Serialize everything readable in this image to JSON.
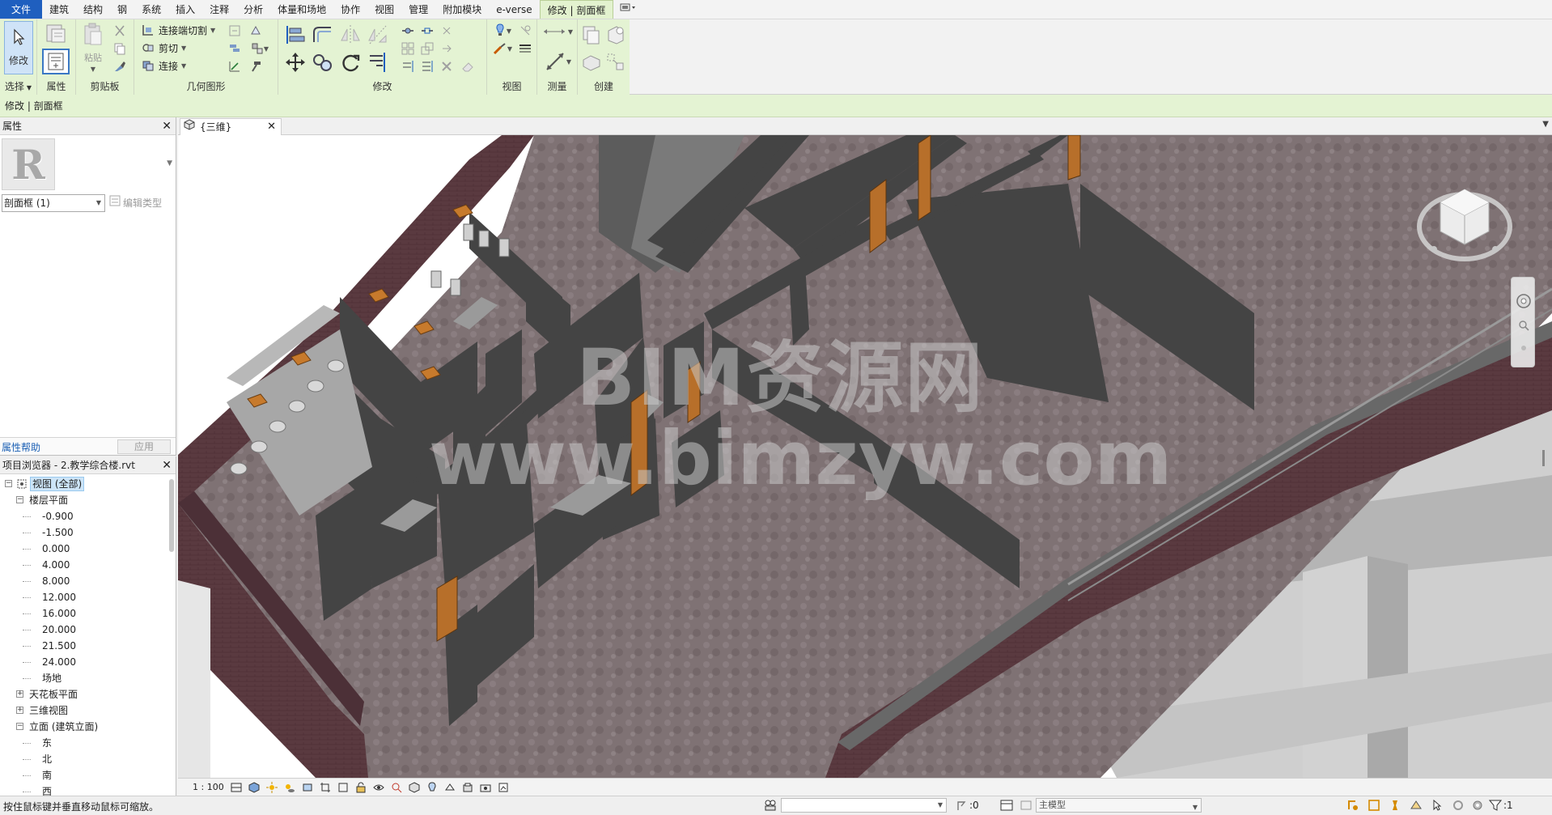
{
  "ribbon": {
    "tabs": [
      {
        "label": "文件",
        "kind": "file"
      },
      {
        "label": "建筑"
      },
      {
        "label": "结构"
      },
      {
        "label": "钢"
      },
      {
        "label": "系统"
      },
      {
        "label": "插入"
      },
      {
        "label": "注释"
      },
      {
        "label": "分析"
      },
      {
        "label": "体量和场地"
      },
      {
        "label": "协作"
      },
      {
        "label": "视图"
      },
      {
        "label": "管理"
      },
      {
        "label": "附加模块"
      },
      {
        "label": "e-verse"
      },
      {
        "label": "修改 | 剖面框",
        "kind": "active"
      }
    ],
    "panels": {
      "select": "选择",
      "properties": "属性",
      "clipboard": "剪贴板",
      "geometry": "几何图形",
      "modify": "修改",
      "view": "视图",
      "measure": "测量",
      "create": "创建"
    },
    "buttons": {
      "modify": "修改",
      "paste": "粘贴",
      "cope": "连接端切割",
      "cut": "剪切",
      "join": "连接"
    }
  },
  "context_bar": "修改 | 剖面框",
  "properties_panel": {
    "title": "属性",
    "type_selector": "剖面框 (1)",
    "edit_type": "编辑类型",
    "help_link": "属性帮助",
    "apply_button": "应用"
  },
  "project_browser": {
    "title": "项目浏览器 - 2.教学综合楼.rvt",
    "tree": [
      {
        "label": "视图 (全部)",
        "level": 0,
        "toggle": "−",
        "selected": true
      },
      {
        "label": "楼层平面",
        "level": 1,
        "toggle": "−"
      },
      {
        "label": "-0.900",
        "level": 2
      },
      {
        "label": "-1.500",
        "level": 2
      },
      {
        "label": "0.000",
        "level": 2
      },
      {
        "label": "4.000",
        "level": 2
      },
      {
        "label": "8.000",
        "level": 2
      },
      {
        "label": "12.000",
        "level": 2
      },
      {
        "label": "16.000",
        "level": 2
      },
      {
        "label": "20.000",
        "level": 2
      },
      {
        "label": "21.500",
        "level": 2
      },
      {
        "label": "24.000",
        "level": 2
      },
      {
        "label": "场地",
        "level": 2
      },
      {
        "label": "天花板平面",
        "level": 1,
        "toggle": "+"
      },
      {
        "label": "三维视图",
        "level": 1,
        "toggle": "+"
      },
      {
        "label": "立面 (建筑立面)",
        "level": 1,
        "toggle": "−"
      },
      {
        "label": "东",
        "level": 2
      },
      {
        "label": "北",
        "level": 2
      },
      {
        "label": "南",
        "level": 2
      },
      {
        "label": "西",
        "level": 2
      }
    ]
  },
  "view_tab": {
    "label": "{三维}"
  },
  "watermark": {
    "line1": "BIM资源网",
    "line2": "www.bimzyw.com"
  },
  "view_control": {
    "scale": "1 : 100"
  },
  "status": {
    "message": "按住鼠标键并垂直移动鼠标可缩放。",
    "selection_count": ":0",
    "model": "主模型",
    "filter_count": ":1"
  },
  "colors": {
    "file_tab": "#1f5fbf",
    "context_green": "#e4f3d3",
    "floor": "#7d7072",
    "wall_dark": "#434343",
    "door_orange": "#b8702a",
    "brick": "#5c3a41"
  },
  "icons": [
    "modify-arrow-icon",
    "properties-icon",
    "paste-icon",
    "cut-icon",
    "join-icon",
    "move-icon",
    "rotate-icon",
    "mirror-icon",
    "measure-icon",
    "viewcube-icon",
    "zoom-icon",
    "filter-icon",
    "close-icon"
  ]
}
